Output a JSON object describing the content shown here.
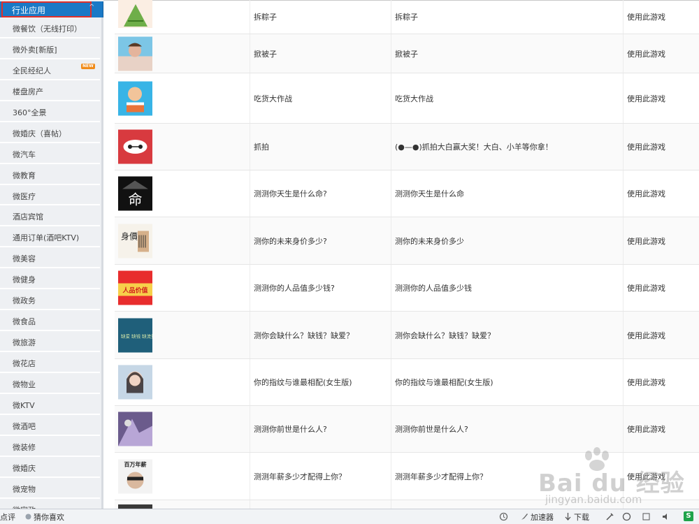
{
  "sidebar": {
    "header": "行业应用",
    "items": [
      {
        "label": "微餐饮（无线打印）"
      },
      {
        "label": "微外卖[新版]"
      },
      {
        "label": "全民经纪人",
        "badge": "NEW"
      },
      {
        "label": "楼盘房产"
      },
      {
        "label": "360°全景"
      },
      {
        "label": "微婚庆（喜帖）"
      },
      {
        "label": "微汽车"
      },
      {
        "label": "微教育"
      },
      {
        "label": "微医疗"
      },
      {
        "label": "酒店宾馆"
      },
      {
        "label": "通用订单(酒吧KTV)"
      },
      {
        "label": "微美容"
      },
      {
        "label": "微健身"
      },
      {
        "label": "微政务"
      },
      {
        "label": "微食品"
      },
      {
        "label": "微旅游"
      },
      {
        "label": "微花店"
      },
      {
        "label": "微物业"
      },
      {
        "label": "微KTV"
      },
      {
        "label": "微酒吧"
      },
      {
        "label": "微装修"
      },
      {
        "label": "微婚庆"
      },
      {
        "label": "微宠物"
      },
      {
        "label": "微家政"
      }
    ]
  },
  "games": [
    {
      "name": "拆粽子",
      "desc": "拆粽子",
      "action": "使用此游戏",
      "thumb": "zongzi-thumbnail"
    },
    {
      "name": "掀被子",
      "desc": "掀被子",
      "action": "使用此游戏",
      "thumb": "blanket-thumbnail"
    },
    {
      "name": "吃货大作战",
      "desc": "吃货大作战",
      "action": "使用此游戏",
      "thumb": "foodie-thumbnail"
    },
    {
      "name": "抓拍",
      "desc": "(●—●)抓拍大白赢大奖！大白、小羊等你拿！",
      "action": "使用此游戏",
      "thumb": "baymax-thumbnail"
    },
    {
      "name": "测测你天生是什么命?",
      "desc": "测测你天生是什么命",
      "action": "使用此游戏",
      "thumb": "fate-thumbnail",
      "thumb_text": "命"
    },
    {
      "name": "测你的未来身价多少?",
      "desc": "测你的未来身价多少",
      "action": "使用此游戏",
      "thumb": "worth-thumbnail",
      "thumb_text": "身價"
    },
    {
      "name": "测测你的人品值多少钱?",
      "desc": "测测你的人品值多少钱",
      "action": "使用此游戏",
      "thumb": "character-thumbnail",
      "thumb_text": "人品价值"
    },
    {
      "name": "测你会缺什么？缺钱？缺爱？",
      "desc": "测你会缺什么？缺钱？缺爱？",
      "action": "使用此游戏",
      "thumb": "lacking-thumbnail",
      "thumb_text": "缺爱 缺钱 缺流量!"
    },
    {
      "name": "你的指纹与谁最相配(女生版)",
      "desc": "你的指纹与谁最相配(女生版)",
      "action": "使用此游戏",
      "thumb": "fingerprint-thumbnail"
    },
    {
      "name": "测测你前世是什么人?",
      "desc": "测测你前世是什么人?",
      "action": "使用此游戏",
      "thumb": "pastlife-thumbnail"
    },
    {
      "name": "测测年薪多少才配得上你？",
      "desc": "测测年薪多少才配得上你？",
      "action": "使用此游戏",
      "thumb": "salary-thumbnail",
      "thumb_text": "百万年薪"
    }
  ],
  "taskbar": {
    "left_text": "点评",
    "guess": "猜你喜欢",
    "accelerator": "加速器",
    "download": "下载"
  },
  "watermark": {
    "brand": "Bai du 经验",
    "url": "jingyan.baidu.com"
  },
  "colors": {
    "sidebar_header": "#1a79c6",
    "highlight_border": "#e0302a",
    "new_badge": "#f08b1a"
  }
}
